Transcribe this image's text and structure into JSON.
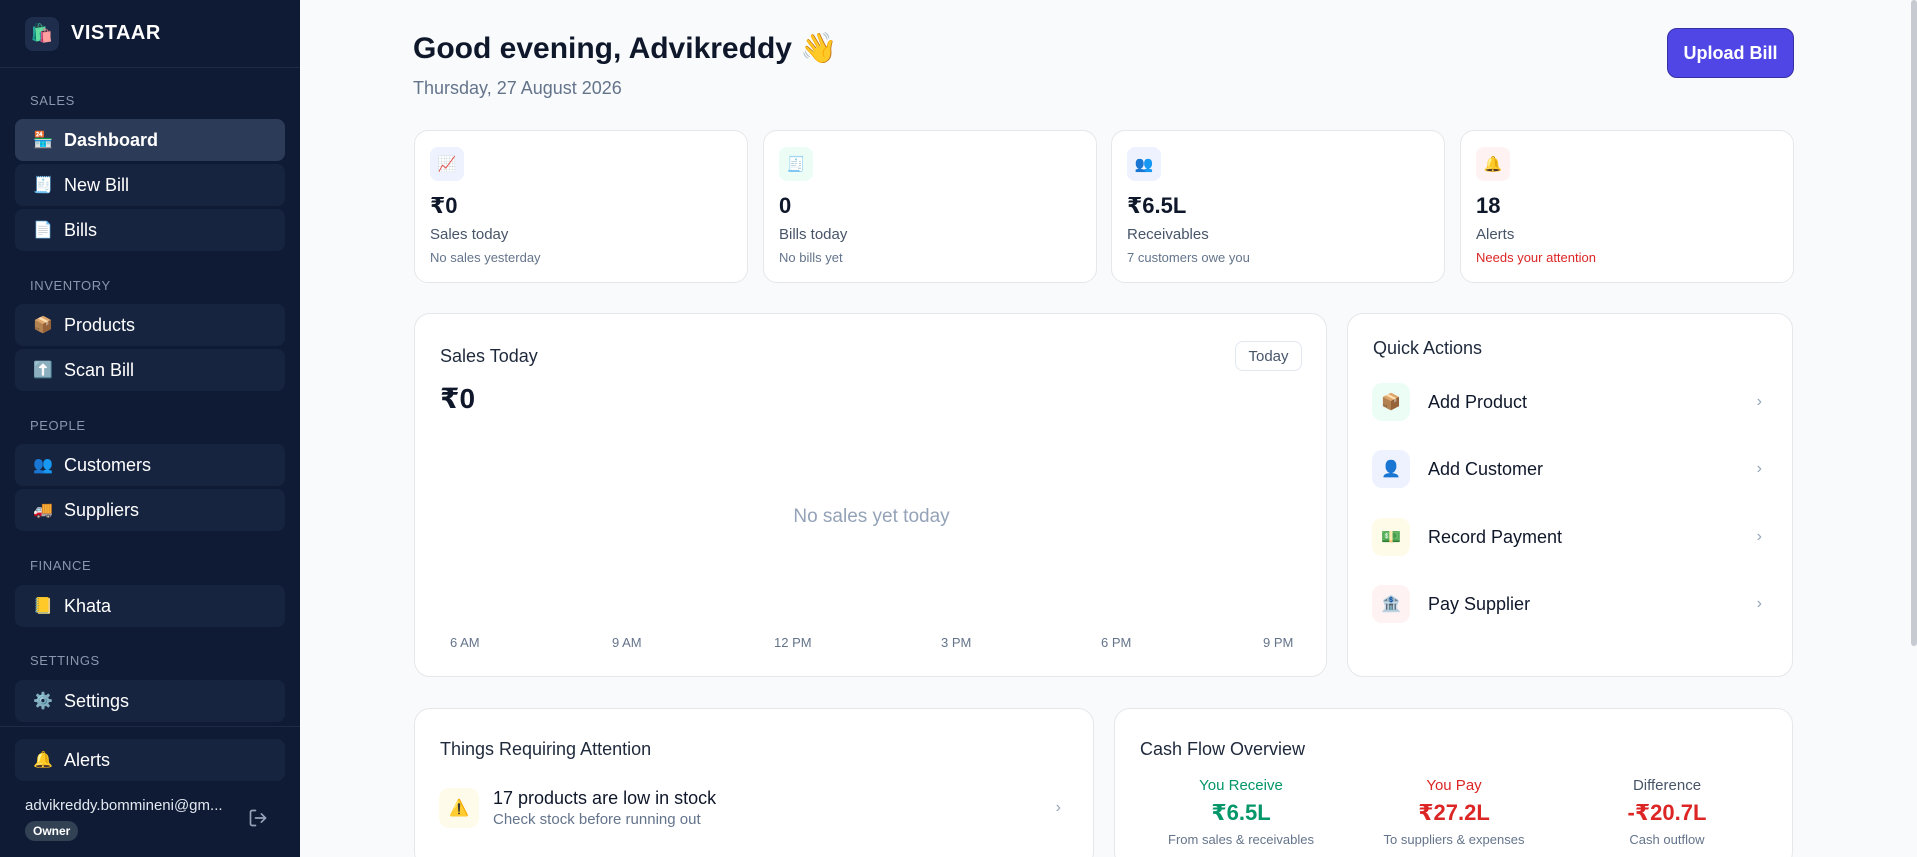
{
  "brand": {
    "logo": "🛍️",
    "name": "VISTAAR"
  },
  "sidebar": {
    "sections": [
      {
        "label": "SALES"
      },
      {
        "label": "INVENTORY"
      },
      {
        "label": "PEOPLE"
      },
      {
        "label": "FINANCE"
      },
      {
        "label": "SETTINGS"
      }
    ],
    "items": [
      {
        "icon": "🏪",
        "label": "Dashboard"
      },
      {
        "icon": "🧾",
        "label": "New Bill"
      },
      {
        "icon": "📄",
        "label": "Bills"
      },
      {
        "icon": "📦",
        "label": "Products"
      },
      {
        "icon": "⬆️",
        "label": "Scan Bill"
      },
      {
        "icon": "👥",
        "label": "Customers"
      },
      {
        "icon": "🚚",
        "label": "Suppliers"
      },
      {
        "icon": "📒",
        "label": "Khata"
      },
      {
        "icon": "⚙️",
        "label": "Settings"
      }
    ],
    "alerts": {
      "icon": "🔔",
      "label": "Alerts"
    },
    "user": {
      "email": "advikreddy.bommineni@gm...",
      "role": "Owner"
    }
  },
  "header": {
    "greeting": "Good evening, Advikreddy 👋",
    "date": "Thursday, 27 August 2026",
    "upload_label": "Upload Bill"
  },
  "stats": [
    {
      "icon": "📈",
      "value": "₹0",
      "label": "Sales today",
      "sub": "No sales yesterday",
      "color": "#eef2ff"
    },
    {
      "icon": "🧾",
      "value": "0",
      "label": "Bills today",
      "sub": "No bills yet",
      "color": "#ecfdf5"
    },
    {
      "icon": "👥",
      "value": "₹6.5L",
      "label": "Receivables",
      "sub": "7 customers owe you",
      "color": "#eef2ff"
    },
    {
      "icon": "🔔",
      "value": "18",
      "label": "Alerts",
      "sub": "Needs your attention",
      "color": "#fef2f2",
      "sub_color": "#dc2626"
    }
  ],
  "sales": {
    "title": "Sales Today",
    "total": "₹0",
    "range_label": "Today",
    "empty": "No sales yet today",
    "ticks": [
      "6 AM",
      "9 AM",
      "12 PM",
      "3 PM",
      "6 PM",
      "9 PM"
    ]
  },
  "quick_actions": {
    "title": "Quick Actions",
    "items": [
      {
        "icon": "📦",
        "label": "Add Product",
        "color": "#ecfdf5"
      },
      {
        "icon": "👤",
        "label": "Add Customer",
        "color": "#eef2ff"
      },
      {
        "icon": "💵",
        "label": "Record Payment",
        "color": "#fefce8"
      },
      {
        "icon": "🏦",
        "label": "Pay Supplier",
        "color": "#fef2f2"
      }
    ],
    "chevron": "›"
  },
  "attention": {
    "title": "Things Requiring Attention",
    "items": [
      {
        "icon": "⚠️",
        "title": "17 products are low in stock",
        "sub": "Check stock before running out"
      }
    ],
    "chevron": "›"
  },
  "cashflow": {
    "title": "Cash Flow Overview",
    "columns": [
      {
        "head": "You Receive",
        "value": "₹6.5L",
        "sub": "From sales & receivables",
        "color": "#059669"
      },
      {
        "head": "You Pay",
        "value": "₹27.2L",
        "sub": "To suppliers & expenses",
        "color": "#dc2626"
      },
      {
        "head": "Difference",
        "value": "-₹20.7L",
        "sub": "Cash outflow",
        "color": "#dc2626",
        "head_color": "#475569"
      }
    ]
  }
}
